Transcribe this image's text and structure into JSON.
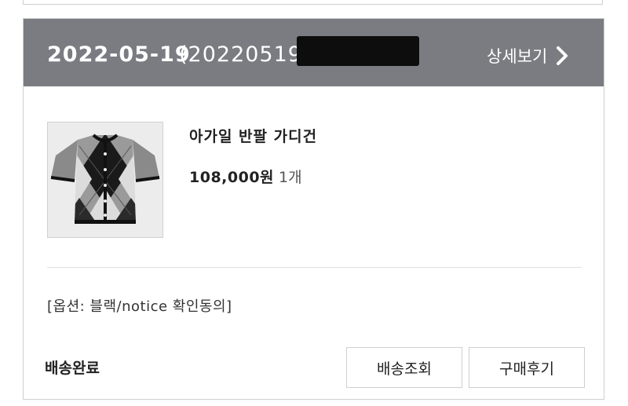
{
  "order": {
    "date": "2022-05-19",
    "number_visible": "(20220519",
    "detail_label": "상세보기",
    "detail_icon": "chevron-right-icon"
  },
  "product": {
    "name": "아가일 반팔 가디건",
    "price": "108,000원",
    "quantity": "1개",
    "image_icon": "argyle-cardigan-thumbnail"
  },
  "option": {
    "text": "[옵션: 블랙/notice 확인동의]"
  },
  "shipping": {
    "status": "배송완료",
    "tracking_label": "배송조회",
    "review_label": "구매후기"
  },
  "colors": {
    "header_bg": "#7a7c82",
    "border": "#cfcfcf"
  }
}
